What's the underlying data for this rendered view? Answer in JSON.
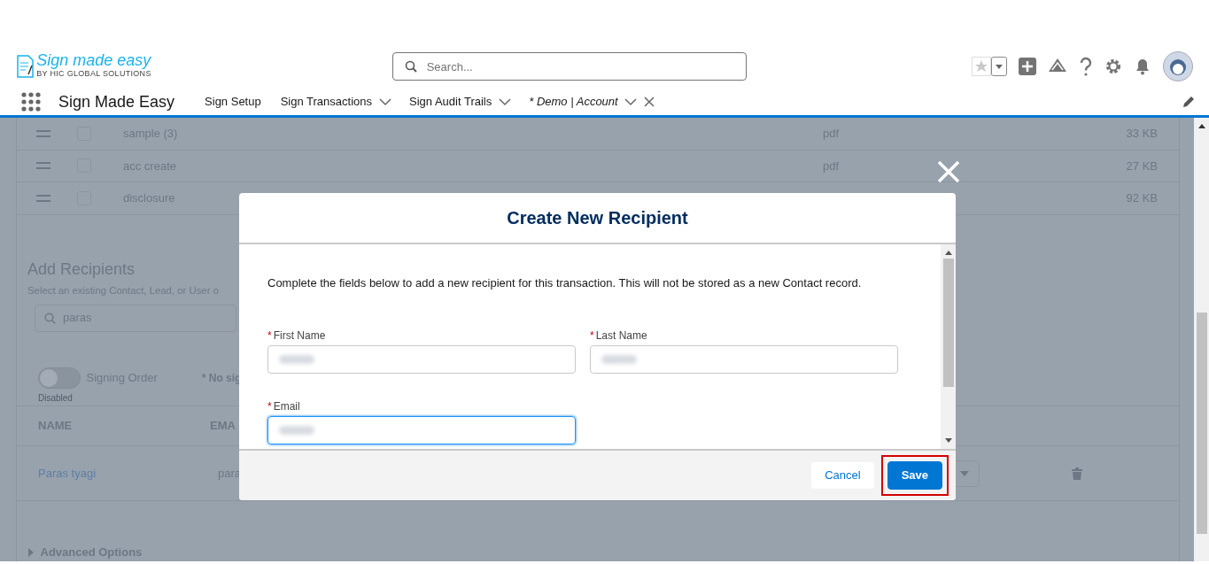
{
  "header": {
    "logo": {
      "title": "Sign made easy",
      "subtitle": "BY HIC GLOBAL SOLUTIONS"
    },
    "search": {
      "placeholder": "Search..."
    }
  },
  "nav": {
    "app_name": "Sign Made Easy",
    "items": [
      {
        "label": "Sign Setup",
        "kind": "link"
      },
      {
        "label": "Sign Transactions",
        "kind": "menu"
      },
      {
        "label": "Sign Audit Trails",
        "kind": "menu"
      },
      {
        "label": "* Demo | Account",
        "kind": "tab"
      }
    ]
  },
  "files": [
    {
      "name": "sample (3)",
      "checked": false,
      "type": "pdf",
      "size": "33 KB"
    },
    {
      "name": "acc create",
      "checked": false,
      "type": "pdf",
      "size": "27 KB"
    },
    {
      "name": "disclosure",
      "checked": false,
      "size": "92 KB"
    }
  ],
  "recipients": {
    "title": "Add Recipients",
    "subtitle": "Select an existing Contact, Lead, or User o",
    "search": {
      "value": "paras"
    },
    "signing_order": {
      "label": "Signing Order",
      "on": false,
      "status": "Disabled"
    },
    "note": "* No sig",
    "columns": [
      "NAME",
      "EMA"
    ],
    "rows": [
      {
        "name": "Paras tyagi",
        "email": "para"
      }
    ]
  },
  "advanced_options": {
    "label": "Advanced Options",
    "expanded": false
  },
  "modal": {
    "title": "Create New Recipient",
    "description": "Complete the fields below to add a new recipient for this transaction. This will not be stored as a new Contact record.",
    "fields": [
      {
        "label": "First Name",
        "required_mark": "*",
        "focused": false
      },
      {
        "label": "Last Name",
        "required_mark": "*",
        "focused": false
      },
      {
        "label": "Email",
        "required_mark": "*",
        "focused": true
      }
    ],
    "buttons": [
      {
        "label": "Cancel",
        "kind": "neutral",
        "highlighted": false
      },
      {
        "label": "Save",
        "kind": "brand",
        "highlighted": true
      }
    ]
  }
}
